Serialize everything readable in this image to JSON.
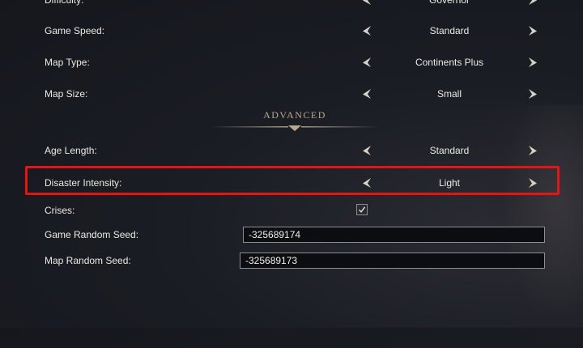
{
  "settings": {
    "difficulty": {
      "label": "Difficulty:",
      "value": "Governor"
    },
    "game_speed": {
      "label": "Game Speed:",
      "value": "Standard"
    },
    "map_type": {
      "label": "Map Type:",
      "value": "Continents Plus"
    },
    "map_size": {
      "label": "Map Size:",
      "value": "Small"
    }
  },
  "advanced": {
    "title": "ADVANCED",
    "age_length": {
      "label": "Age Length:",
      "value": "Standard"
    },
    "disaster_intensity": {
      "label": "Disaster Intensity:",
      "value": "Light"
    },
    "crises": {
      "label": "Crises:",
      "checked": true
    },
    "game_random_seed": {
      "label": "Game Random Seed:",
      "value": "-325689174"
    },
    "map_random_seed": {
      "label": "Map Random Seed:",
      "value": "-325689173"
    }
  },
  "colors": {
    "highlight": "#ee1111",
    "section_title": "#b9a98d",
    "arrow_fill": "#d8d2c4"
  },
  "icons": {
    "left_arrow": "chevron-left-icon",
    "right_arrow": "chevron-right-icon",
    "check": "check-icon",
    "ornament": "section-divider-ornament"
  }
}
